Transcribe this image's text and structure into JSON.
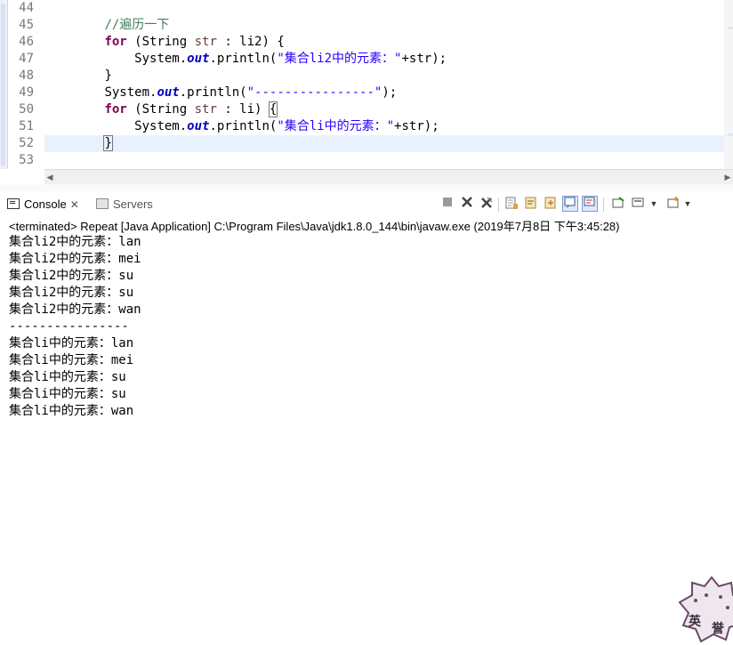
{
  "editor": {
    "line_numbers": [
      "44",
      "45",
      "46",
      "47",
      "48",
      "49",
      "50",
      "51",
      "52",
      "53"
    ],
    "lines": {
      "l44": "",
      "l45": {
        "comment": "//遍历一下"
      },
      "l46": {
        "kw": "for",
        "a": " (String ",
        "var": "str",
        "b": " : li2) {"
      },
      "l47": {
        "pre": "System.",
        "field": "out",
        "mid": ".println(",
        "str": "\"集合li2中的元素：\"",
        "post": "+str);"
      },
      "l48": {
        "text": "}"
      },
      "l49": {
        "pre": "System.",
        "field": "out",
        "mid": ".println(",
        "str": "\"----------------\"",
        "post": ");"
      },
      "l50": {
        "kw": "for",
        "a": " (String ",
        "var": "str",
        "b": " : li) ",
        "brace": "{"
      },
      "l51": {
        "pre": "System.",
        "field": "out",
        "mid": ".println(",
        "str": "\"集合li中的元素：\"",
        "post": "+str);"
      },
      "l52": {
        "text": "}"
      },
      "l53": ""
    }
  },
  "console": {
    "tabs": {
      "console_label": "Console",
      "console_close": "✕",
      "servers_label": "Servers"
    },
    "description": "<terminated> Repeat [Java Application] C:\\Program Files\\Java\\jdk1.8.0_144\\bin\\javaw.exe (2019年7月8日 下午3:45:28)",
    "output": [
      "集合li2中的元素：lan",
      "集合li2中的元素：mei",
      "集合li2中的元素：su",
      "集合li2中的元素：su",
      "集合li2中的元素：wan",
      "----------------",
      "集合li中的元素：lan",
      "集合li中的元素：mei",
      "集合li中的元素：su",
      "集合li中的元素：su",
      "集合li中的元素：wan"
    ],
    "toolbar_icons": [
      "terminate-icon",
      "remove-launch-icon",
      "remove-all-terminated-icon",
      "scroll-lock-icon",
      "word-wrap-icon",
      "pin-console-icon",
      "show-console-on-output-icon",
      "show-console-on-error-icon",
      "open-console-icon",
      "display-selected-console-icon",
      "new-console-icon"
    ]
  },
  "colors": {
    "keyword": "#7f0055",
    "comment": "#3f7f5f",
    "string": "#2a00ff",
    "variable": "#6a3e3e",
    "static_field": "#0000c0",
    "current_line": "#e8f2fe"
  },
  "watermark": {
    "seal_text": "英 誉"
  }
}
